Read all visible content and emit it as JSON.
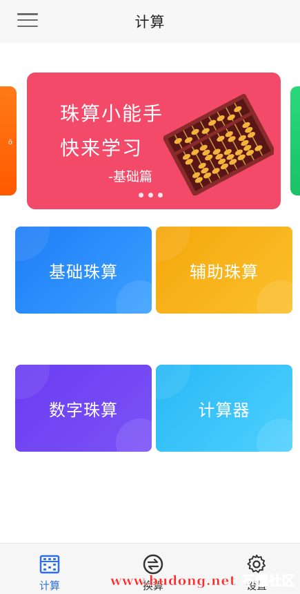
{
  "header": {
    "title": "计算"
  },
  "banner": {
    "line1": "珠算小能手",
    "line2": "快来学习",
    "subtitle": "-基础篇",
    "bg_color": "#f24a68",
    "slide_count": 3
  },
  "tiles": [
    {
      "label": "基础珠算",
      "color": "#1f7df7"
    },
    {
      "label": "辅助珠算",
      "color": "#f5a70b"
    },
    {
      "label": "数字珠算",
      "color": "#6a3df0"
    },
    {
      "label": "计算器",
      "color": "#28b8f5"
    }
  ],
  "bottom_nav": {
    "items": [
      {
        "label": "计算",
        "icon": "abacus-icon",
        "active": true
      },
      {
        "label": "换算",
        "icon": "exchange-icon",
        "active": false
      },
      {
        "label": "设置",
        "icon": "gear-icon",
        "active": false
      }
    ],
    "active_color": "#2f6fe0"
  },
  "watermark": {
    "site": "www.budong.net",
    "brand": "不懂社区"
  }
}
